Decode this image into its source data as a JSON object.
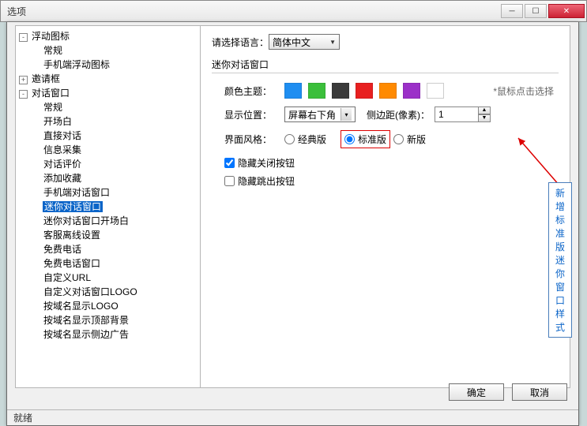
{
  "window": {
    "title": "选项"
  },
  "titlebar_buttons": {
    "min": "─",
    "max": "☐",
    "close": "✕"
  },
  "tree": [
    {
      "indent": 0,
      "toggle": "-",
      "label": "浮动图标"
    },
    {
      "indent": 1,
      "toggle": "",
      "label": "常规"
    },
    {
      "indent": 1,
      "toggle": "",
      "label": "手机端浮动图标"
    },
    {
      "indent": 0,
      "toggle": "+",
      "label": "邀请框"
    },
    {
      "indent": 0,
      "toggle": "-",
      "label": "对话窗口"
    },
    {
      "indent": 1,
      "toggle": "",
      "label": "常规"
    },
    {
      "indent": 1,
      "toggle": "",
      "label": "开场白"
    },
    {
      "indent": 1,
      "toggle": "",
      "label": "直接对话"
    },
    {
      "indent": 1,
      "toggle": "",
      "label": "信息采集"
    },
    {
      "indent": 1,
      "toggle": "",
      "label": "对话评价"
    },
    {
      "indent": 1,
      "toggle": "",
      "label": "添加收藏"
    },
    {
      "indent": 1,
      "toggle": "",
      "label": "手机端对话窗口"
    },
    {
      "indent": 1,
      "toggle": "",
      "label": "迷你对话窗口",
      "selected": true
    },
    {
      "indent": 1,
      "toggle": "",
      "label": "迷你对话窗口开场白"
    },
    {
      "indent": 1,
      "toggle": "",
      "label": "客服离线设置"
    },
    {
      "indent": 1,
      "toggle": "",
      "label": "免费电话"
    },
    {
      "indent": 1,
      "toggle": "",
      "label": "免费电话窗口"
    },
    {
      "indent": 1,
      "toggle": "",
      "label": "自定义URL"
    },
    {
      "indent": 1,
      "toggle": "",
      "label": "自定义对话窗口LOGO"
    },
    {
      "indent": 1,
      "toggle": "",
      "label": "按域名显示LOGO"
    },
    {
      "indent": 1,
      "toggle": "",
      "label": "按域名显示顶部背景"
    },
    {
      "indent": 1,
      "toggle": "",
      "label": "按域名显示侧边广告"
    }
  ],
  "panel": {
    "lang_label": "请选择语言：",
    "lang_value": "简体中文",
    "section_title": "迷你对话窗口",
    "theme_label": "颜色主题：",
    "theme_colors": [
      "#1f8ef1",
      "#3bbf3b",
      "#3a3a3a",
      "#e82020",
      "#ff8a00",
      "#9b30c8",
      "#ffffff"
    ],
    "theme_hint": "*鼠标点击选择",
    "pos_label": "显示位置：",
    "pos_value": "屏幕右下角",
    "margin_label": "侧边距(像素)：",
    "margin_value": "1",
    "style_label": "界面风格：",
    "style_options": {
      "classic": "经典版",
      "standard": "标准版",
      "new": "新版"
    },
    "chk_hide_close": "隐藏关闭按钮",
    "chk_hide_popup": "隐藏跳出按钮",
    "callout": "新增标准版迷你窗口样式"
  },
  "footer": {
    "ok": "确定",
    "cancel": "取消"
  },
  "status": "就绪"
}
